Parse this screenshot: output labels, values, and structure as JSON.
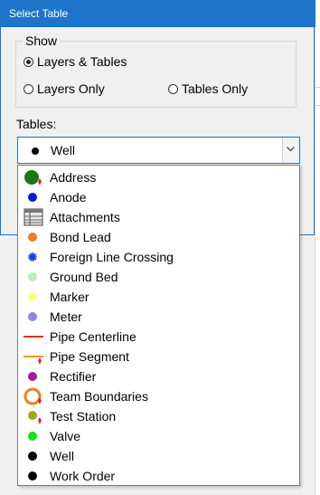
{
  "dialog": {
    "title": "Select Table"
  },
  "show": {
    "label": "Show",
    "options": [
      "Layers & Tables",
      "Layers Only",
      "Tables Only"
    ],
    "selected": "Layers & Tables"
  },
  "tables": {
    "label": "Tables:",
    "selected": "Well",
    "items": [
      {
        "label": "Address",
        "icon": "address-icon",
        "color": "#157a15"
      },
      {
        "label": "Anode",
        "icon": "anode-icon",
        "color": "#0b17d8"
      },
      {
        "label": "Attachments",
        "icon": "attachments-table-icon",
        "color": "#555555"
      },
      {
        "label": "Bond Lead",
        "icon": "bond-lead-icon",
        "color": "#ee7d1c"
      },
      {
        "label": "Foreign Line Crossing",
        "icon": "foreign-line-crossing-icon",
        "color": "#1c3ee0"
      },
      {
        "label": "Ground Bed",
        "icon": "ground-bed-icon",
        "color": "#b9f0b9"
      },
      {
        "label": "Marker",
        "icon": "marker-icon",
        "color": "#fdfd8a"
      },
      {
        "label": "Meter",
        "icon": "meter-icon",
        "color": "#8a88e8"
      },
      {
        "label": "Pipe Centerline",
        "icon": "pipe-centerline-icon",
        "color": "#e2301d"
      },
      {
        "label": "Pipe Segment",
        "icon": "pipe-segment-icon",
        "color": "#f0981d"
      },
      {
        "label": "Rectifier",
        "icon": "rectifier-icon",
        "color": "#a01aa0"
      },
      {
        "label": "Team Boundaries",
        "icon": "team-boundaries-icon",
        "color": "#ee7d1c"
      },
      {
        "label": "Test Station",
        "icon": "test-station-icon",
        "color": "#a6a61a"
      },
      {
        "label": "Valve",
        "icon": "valve-icon",
        "color": "#16e016"
      },
      {
        "label": "Well",
        "icon": "well-icon",
        "color": "#000000"
      },
      {
        "label": "Work Order",
        "icon": "work-order-icon",
        "color": "#000000"
      }
    ]
  }
}
